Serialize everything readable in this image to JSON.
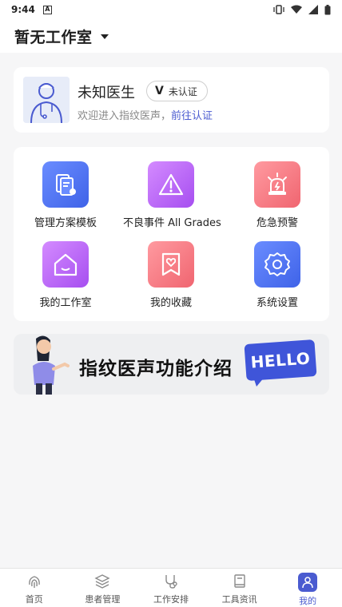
{
  "status_bar": {
    "time": "9:44",
    "notification_letter": "A"
  },
  "header": {
    "title": "暂无工作室"
  },
  "profile": {
    "name": "未知医生",
    "verify_badge_letter": "V",
    "verify_status": "未认证",
    "welcome_text": "欢迎进入指纹医声，",
    "verify_link": "前往认证"
  },
  "functions": [
    {
      "label": "管理方案模板",
      "icon": "document-gear-icon"
    },
    {
      "label": "不良事件 All Grades",
      "icon": "warning-icon"
    },
    {
      "label": "危急预警",
      "icon": "alarm-light-icon"
    },
    {
      "label": "我的工作室",
      "icon": "home-icon"
    },
    {
      "label": "我的收藏",
      "icon": "heart-bookmark-icon"
    },
    {
      "label": "系统设置",
      "icon": "gear-icon"
    }
  ],
  "banner": {
    "text": "指纹医声功能介绍",
    "badge": "HELLO"
  },
  "tabbar": {
    "tabs": [
      {
        "label": "首页",
        "icon": "fingerprint-icon",
        "active": false
      },
      {
        "label": "患者管理",
        "icon": "layers-icon",
        "active": false
      },
      {
        "label": "工作安排",
        "icon": "stethoscope-icon",
        "active": false
      },
      {
        "label": "工具资讯",
        "icon": "book-icon",
        "active": false
      },
      {
        "label": "我的",
        "icon": "user-icon",
        "active": true
      }
    ]
  },
  "colors": {
    "accent": "#4a5bd0",
    "background": "#f6f6f7"
  }
}
